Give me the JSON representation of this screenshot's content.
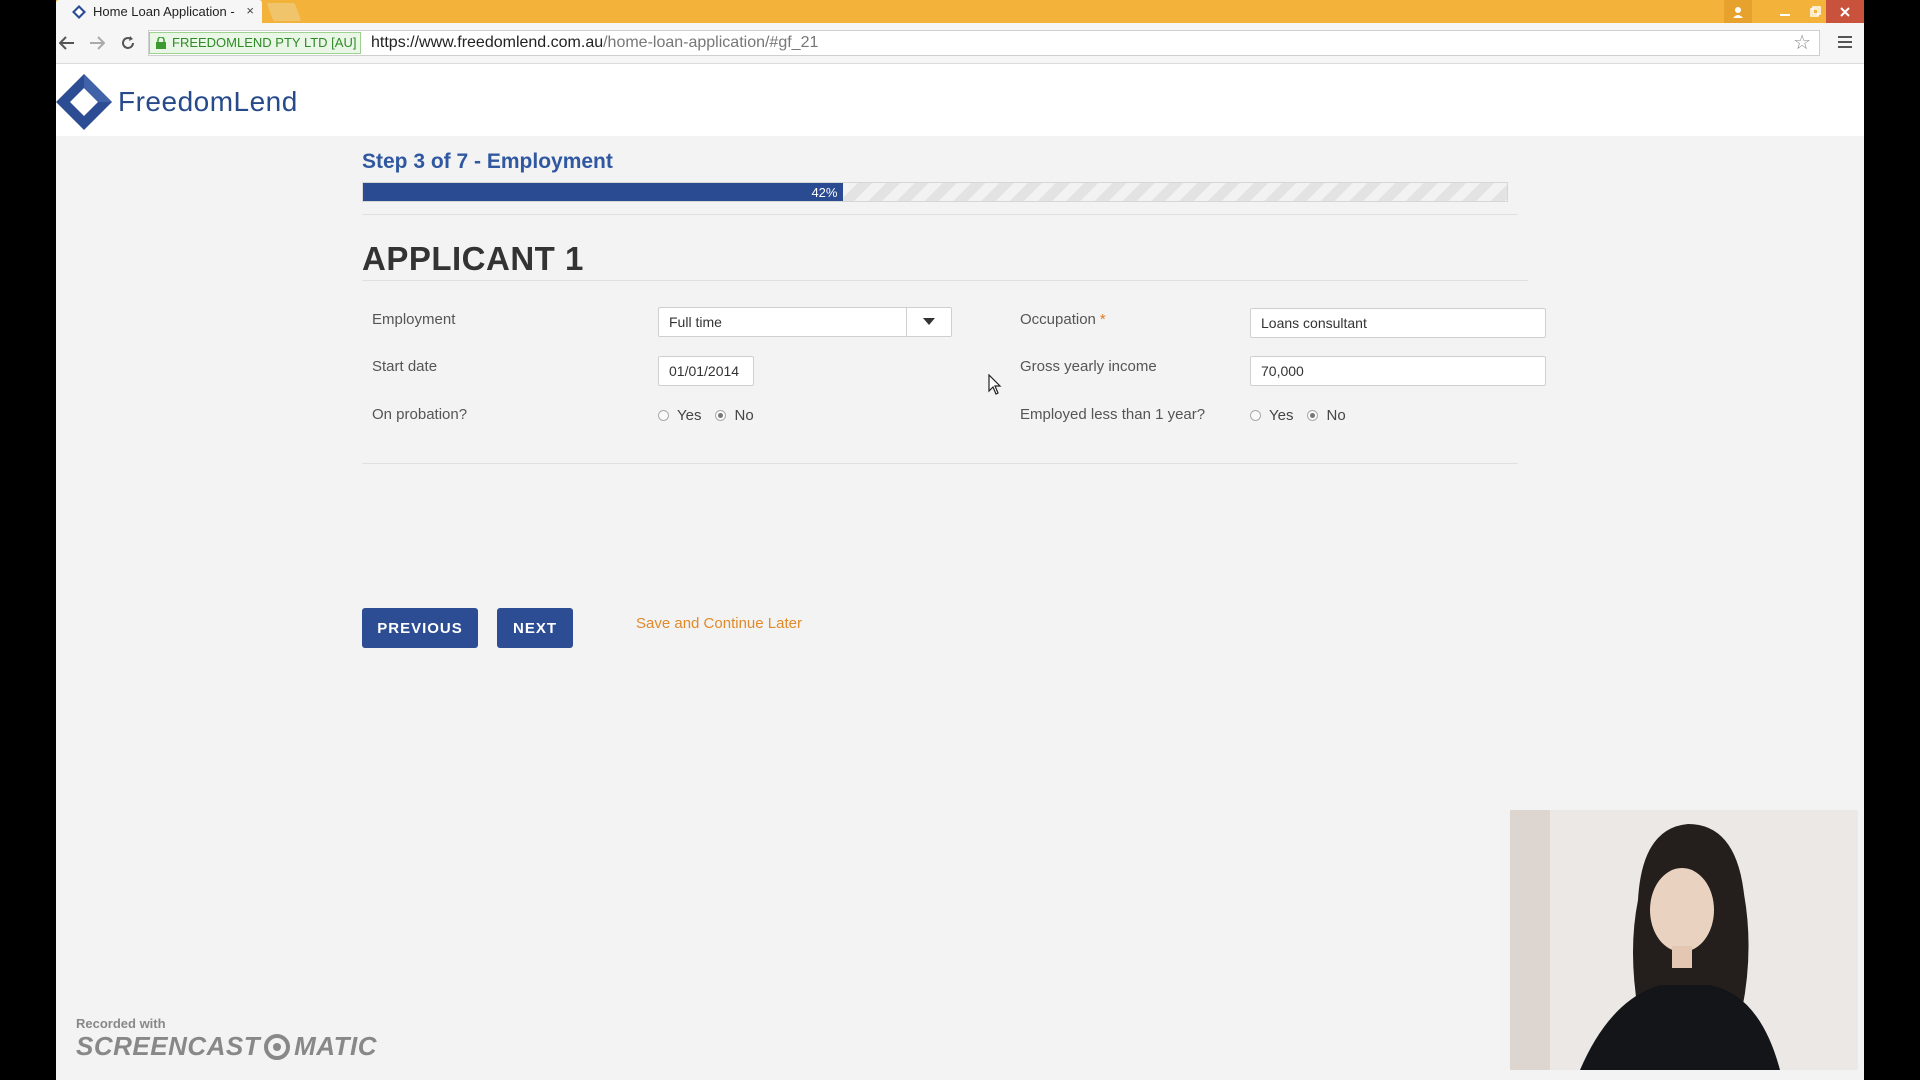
{
  "browser": {
    "tab_title": "Home Loan Application -",
    "tab_close": "×",
    "ev_label": "FREEDOMLEND PTY LTD [AU]",
    "url_host": "https://www.freedomlend.com.au",
    "url_path": "/home-loan-application/#gf_21"
  },
  "brand": {
    "name": "FreedomLend",
    "colors": {
      "primary": "#2c4d94",
      "accent": "#e08a2a",
      "titlebar": "#f3b23a"
    }
  },
  "form": {
    "step_title": "Step 3 of 7 - Employment",
    "progress_label": "42%",
    "progress_value": 0.42,
    "applicant_title": "APPLICANT 1",
    "employment": {
      "label": "Employment",
      "value": "Full time"
    },
    "start_date": {
      "label": "Start date",
      "value": "01/01/2014"
    },
    "probation": {
      "label": "On probation?",
      "yes": "Yes",
      "no": "No",
      "selected": "No"
    },
    "occupation": {
      "label": "Occupation",
      "required_mark": "*",
      "value": "Loans consultant"
    },
    "income": {
      "label": "Gross yearly income",
      "value": "70,000"
    },
    "less_than_year": {
      "label": "Employed less than 1 year?",
      "yes": "Yes",
      "no": "No",
      "selected": "No"
    },
    "previous_label": "PREVIOUS",
    "next_label": "NEXT",
    "save_later_label": "Save and Continue Later"
  },
  "watermark": {
    "line1": "Recorded with",
    "line2a": "SCREENCAST",
    "line2b": "MATIC"
  }
}
